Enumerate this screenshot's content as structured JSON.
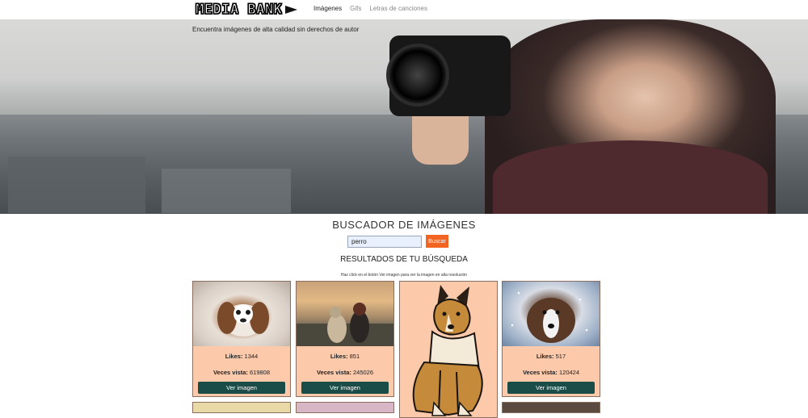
{
  "brand": {
    "name": "MEDIA BANK"
  },
  "nav": {
    "items": [
      {
        "label": "Imágenes",
        "active": true
      },
      {
        "label": "Gifs",
        "active": false
      },
      {
        "label": "Letras de canciones",
        "active": false
      }
    ]
  },
  "hero": {
    "tagline": "Encuentra imágenes de alta calidad sin derechos de autor"
  },
  "search": {
    "title": "BUSCADOR DE IMÁGENES",
    "query": "perro",
    "button_label": "Buscar",
    "button_color": "#f26422"
  },
  "results": {
    "title": "RESULTADOS DE TU BÚSQUEDA",
    "hint": "Haz click en el botón Ver imagen para ver la imagen en alta resolución",
    "likes_label": "Likes:",
    "views_label": "Veces vista:",
    "button_label": "Ver imagen",
    "card_color": "#fcc9ab",
    "button_color": "#1b4d48",
    "cards": [
      {
        "likes": "1344",
        "views": "619808"
      },
      {
        "likes": "851",
        "views": "245026"
      },
      {
        "likes": "517",
        "views": "120424"
      }
    ]
  }
}
